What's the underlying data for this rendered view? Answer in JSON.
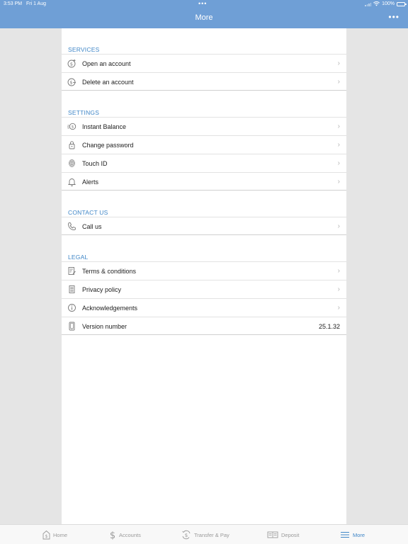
{
  "status": {
    "time": "3:53 PM",
    "date": "Fri 1 Aug",
    "battery": "100%"
  },
  "nav": {
    "title": "More",
    "more_glyph": "•••"
  },
  "colors": {
    "accent": "#3f86c7",
    "header": "#6f9fd6"
  },
  "sections": {
    "services": {
      "title": "SERVICES",
      "items": [
        {
          "label": "Open an account",
          "icon": "dollar-plus-icon"
        },
        {
          "label": "Delete an account",
          "icon": "dollar-minus-icon"
        }
      ]
    },
    "settings": {
      "title": "SETTINGS",
      "items": [
        {
          "label": "Instant Balance",
          "icon": "instant-balance-icon"
        },
        {
          "label": "Change password",
          "icon": "lock-icon"
        },
        {
          "label": "Touch ID",
          "icon": "fingerprint-icon"
        },
        {
          "label": "Alerts",
          "icon": "bell-icon"
        }
      ]
    },
    "contact": {
      "title": "CONTACT US",
      "items": [
        {
          "label": "Call us",
          "icon": "phone-icon"
        }
      ]
    },
    "legal": {
      "title": "LEGAL",
      "items": [
        {
          "label": "Terms & conditions",
          "icon": "document-icon"
        },
        {
          "label": "Privacy policy",
          "icon": "document-list-icon"
        },
        {
          "label": "Acknowledgements",
          "icon": "info-icon"
        },
        {
          "label": "Version number",
          "icon": "device-icon",
          "value": "25.1.32"
        }
      ]
    }
  },
  "tabs": [
    {
      "label": "Home",
      "icon": "home-dollar-icon",
      "active": false
    },
    {
      "label": "Accounts",
      "icon": "dollar-icon",
      "active": false
    },
    {
      "label": "Transfer & Pay",
      "icon": "transfer-icon",
      "active": false
    },
    {
      "label": "Deposit",
      "icon": "check-deposit-icon",
      "active": false
    },
    {
      "label": "More",
      "icon": "menu-icon",
      "active": true
    }
  ],
  "chevron": "›"
}
